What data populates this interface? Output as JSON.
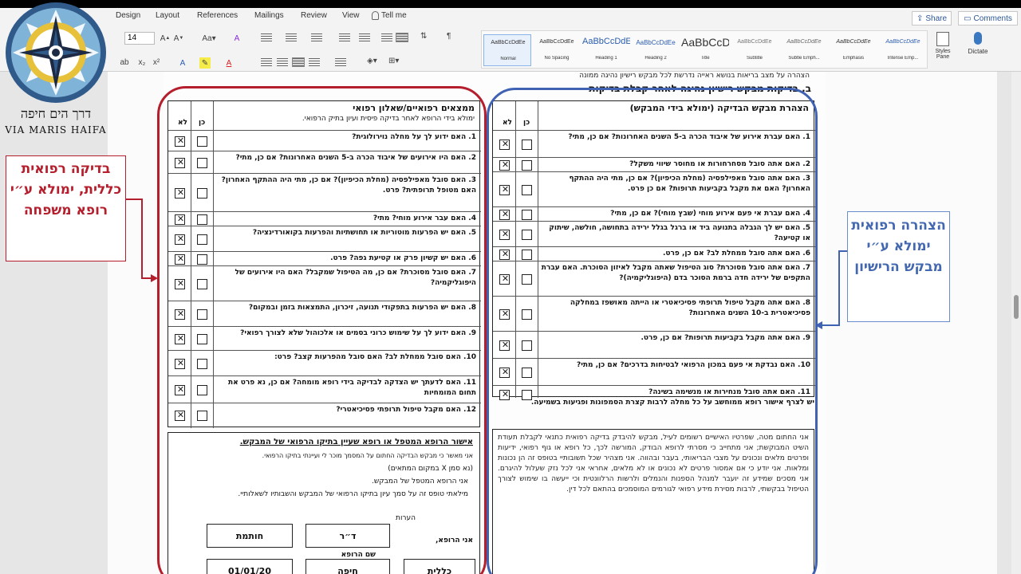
{
  "ribbon": {
    "tabs": [
      "Design",
      "Layout",
      "References",
      "Mailings",
      "Review",
      "View"
    ],
    "tell_me": "Tell me",
    "share": "Share",
    "comments": "Comments",
    "font_size": "14",
    "styles": [
      {
        "preview": "AaBbCcDdEe",
        "name": "Normal"
      },
      {
        "preview": "AaBbCcDdEe",
        "name": "No Spacing"
      },
      {
        "preview": "AaBbCcDdEe",
        "name": "Heading 1"
      },
      {
        "preview": "AaBbCcDdEe",
        "name": "Heading 2"
      },
      {
        "preview": "AaBbCcDdEe",
        "name": "Title"
      },
      {
        "preview": "AaBbCcDdEe",
        "name": "Subtitle"
      },
      {
        "preview": "AaBbCcDdEe",
        "name": "Subtle Emph..."
      },
      {
        "preview": "AaBbCcDdEe",
        "name": "Emphasis"
      },
      {
        "preview": "AaBbCcDdEe",
        "name": "Intense Emp..."
      }
    ],
    "styles_pane": "Styles Pane",
    "dictate": "Dictate"
  },
  "logo": {
    "hebrew": "דרך הים חיפה",
    "english": "VIA MARIS HAIFA"
  },
  "document": {
    "header_text": "הצהרה על מצב בריאות בנושא ראייה נדרשת לכל מבקש רישיון נהיגה ממונה",
    "section_title": "ב. בדיקות מבקש רישיון נהיגה לאחר קבלת בדיקות",
    "medical_panel": {
      "title": "ממצאים רפואיים/שאלון רפואי",
      "subtitle": "ימולא בידי הרופא לאחר בדיקה פיסית ועיון בתיק הרפואי.",
      "yes": "כן",
      "no": "לא",
      "questions": [
        "1. האם ידוע לך על מחלה נוירולוגית?",
        "2. האם היו אירועים של איבוד הכרה ב-5 השנים האחרונות? אם כן, מתי?",
        "3. האם סובל מאפילפסיה (מחלת הכיפיון)? אם כן, מתי היה ההתקף האחרון? האם מטופל תרופתית? פרט.",
        "4. האם עבר אירוע מוחי? מתי?",
        "5. האם יש הפרעות מוטוריות או תחושתיות והפרעות בקואורדינציה?",
        "6. האם יש קשיון פרק או קטיעת גפה? פרט.",
        "7. האם סובל מסוכרת? אם כן, מה הטיפול שמקבל? האם היו אירועים של היפוגליקמיה?",
        "8. האם יש הפרעות בתפקודי תנועה, זיכרון, התמצאות בזמן ובמקום?",
        "9. האם ידוע לך על שימוש כרוני בסמים או אלכוהול שלא לצורך רפואי?",
        "10. האם סובל ממחלת לב? האם סובל מהפרעות קצב? פרט:",
        "11. האם לדעתך יש הצדקה לבדיקה בידי רופא מומחה? אם כן, נא פרט את תחום המומחיות",
        "12. האם מקבל טיפול תרופתי פסיכיאטרי?"
      ],
      "doctor_confirm_title": "אישור הרופא המטפל או רופא שעיין בתיקו הרפואי של המבקש.",
      "doctor_confirm_sub": "אני מאשר כי מבקש הבדיקה החתום על המסמך מוכר לי ועיינתי בתיקו הרפואי.",
      "mark_note": "(נא סמן X במקום המתאים)",
      "line1": "אני הרופא המטפל של המבקש.",
      "line2": "מילאתי טופס זה על סמך עיון בתיקו הרפואי של המבקש והשבותיו לשאלותיי.",
      "remarks": "הערות",
      "doctor_label": "אני הרופא,",
      "stamp": "חותמת",
      "dr": "ד״ר",
      "doctor_name_label": "שם הרופא",
      "date": "01/01/20",
      "city": "חיפה",
      "general": "כללית"
    },
    "applicant_panel": {
      "title": "הצהרת מבקש הבדיקה (ימולא בידי המבקש)",
      "yes": "כן",
      "no": "לא",
      "questions": [
        "1. האם עברת אירוע של איבוד הכרה ב-5 השנים האחרונות? אם כן, מתי?",
        "2. האם אתה סובל מסחרחורות או מחוסר שיווי משקל?",
        "3. האם אתה סובל מאפילפסיה (מחלת הכיפיון)? אם כן, מתי היה ההתקף האחרון? האם את מקבל בקביעות תרופות? אם כן פרט.",
        "4. האם עברת אי פעם אירוע מוחי (שבץ מוחי)? אם כן, מתי?",
        "5. האם יש לך הגבלה בתנועה ביד או ברגל בגלל ירידה בתחושה, חולשה, שיתוק או קטיעה?",
        "6. האם אתה סובל ממחלת לב? אם כן, פרט.",
        "7. האם אתה סובל מסוכרת? סוג הטיפול שאתה מקבל לאיזון הסוכרת. האם עברת התקפים של ירידה חדה ברמת הסוכר בדם (היפוגליקמיה)?",
        "8. האם אתה מקבל טיפול תרופתי פסיכיאטרי או הייתה מאושפז במחלקה פסיכיאטרית ב-10 השנים האחרונות?",
        "9. האם אתה מקבל בקביעות תרופות? אם כן, פרט.",
        "10. האם נבדקת אי פעם במכון הרפואי לבטיחות בדרכים? אם כן, מתי?",
        "11. האם אתה סובל מנחירות או מנשימה בשינה?"
      ],
      "note": "יש לצרף אישור רופא ממוחשב על כל מחלה לרבות קצרת הסמפונות ופגיעות בשמיעה.",
      "consent": "אני החתום מטה, שפרטיו האישיים רשומים לעיל, מבקש להיבדק בדיקה רפואית כתנאי לקבלת תעודת השיט המבוקשת; אני מתחייב כי מסרתי לרופא הבודק, המורשה לכך, כל רופא או גוף רפואי, ידיעות ופרטים מלאים ונכונים על מצבי הבריאותי, בעבר ובהווה. אני מצהיר שכל תשובותיי בטופס זה הן נכונות ומלאות. אני יודע כי אם אמסור פרטים לא נכונים או לא מלאים, אחראי אני לכל נזק שעלול להיגרם. אני מסכים שמידע זה יועבר למנהל הספנות והנמלים ולרשות הרלוונטית וכי ייעשה בו שימוש לצורך הטיפול בבקשתי, לרבות מסירת מידע רפואי לגורמים המוסמכים בהתאם לכל דין."
    }
  },
  "annotations": {
    "red_note": "בדיקה רפואית כללית, ימולא ע״י רופא משפחה",
    "blue_note": "הצהרה רפואית ימולא ע״י מבקש הרישיון",
    "red_color": "#b51e2c",
    "blue_color": "#3f62b3"
  }
}
